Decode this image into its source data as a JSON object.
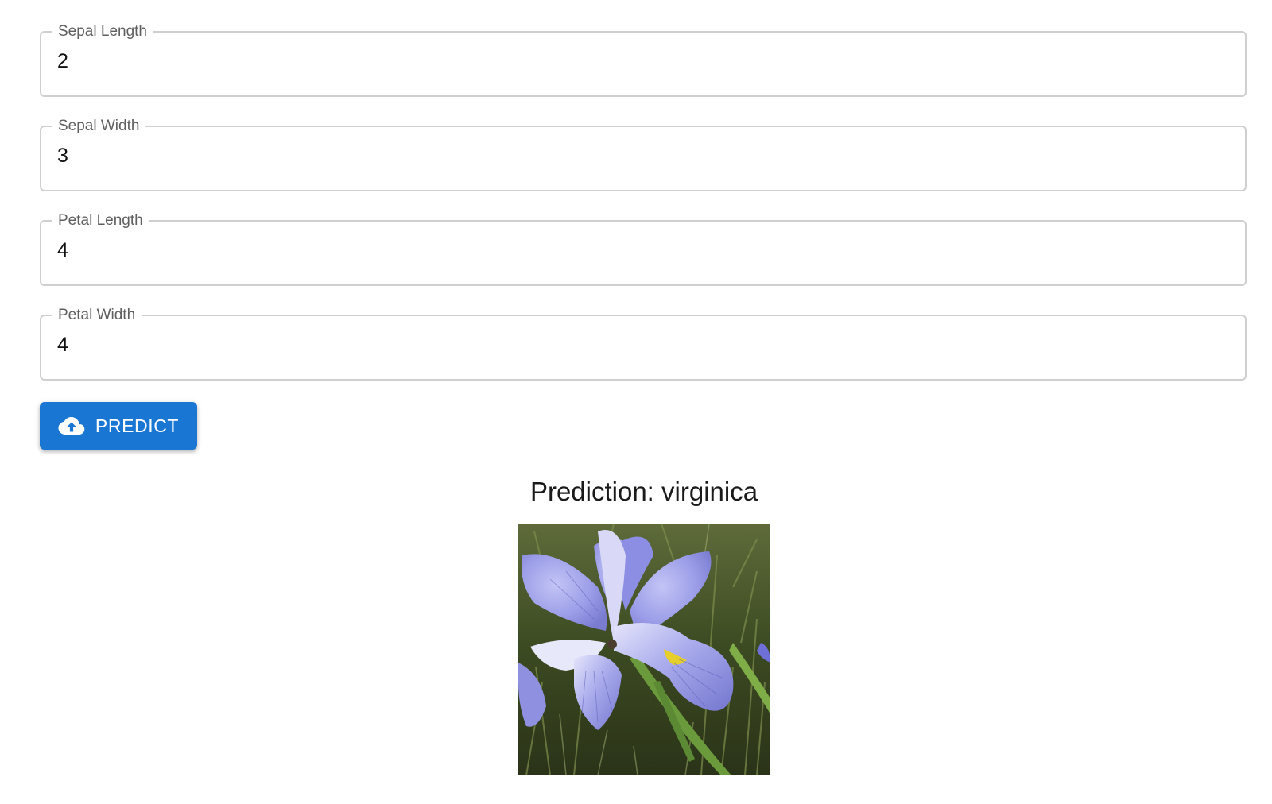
{
  "form": {
    "fields": [
      {
        "label": "Sepal Length",
        "value": "2"
      },
      {
        "label": "Sepal Width",
        "value": "3"
      },
      {
        "label": "Petal Length",
        "value": "4"
      },
      {
        "label": "Petal Width",
        "value": "4"
      }
    ],
    "predict_button": {
      "label": "PREDICT",
      "icon": "cloud-upload-icon"
    }
  },
  "result": {
    "text": "Prediction: virginica",
    "image": {
      "alt": "virginica"
    }
  },
  "colors": {
    "button": "#1976d2",
    "field_border": "#cfcfcf",
    "label": "#5f5f5f"
  }
}
